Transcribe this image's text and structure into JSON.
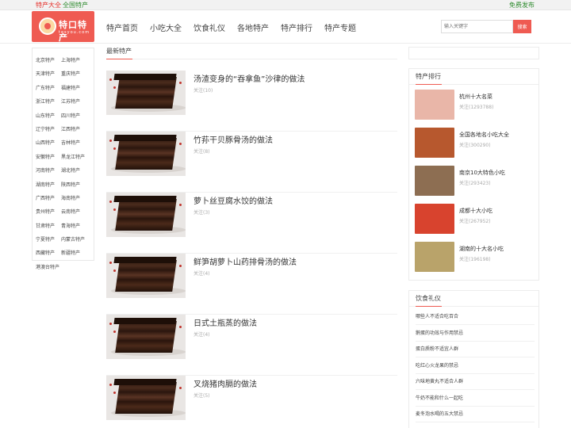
{
  "topbar": {
    "link1": "特产大全",
    "link2": "全国特产",
    "right": "免费发布"
  },
  "logo": {
    "text": "特口特产",
    "domain": "tesyou.com"
  },
  "nav": [
    "特产首页",
    "小吃大全",
    "饮食礼仪",
    "各地特产",
    "特产排行",
    "特产专题"
  ],
  "search": {
    "placeholder": "输入关键字",
    "button": "搜索"
  },
  "regions": [
    "北京特产",
    "上海特产",
    "天津特产",
    "重庆特产",
    "广东特产",
    "福建特产",
    "浙江特产",
    "江苏特产",
    "山东特产",
    "四川特产",
    "辽宁特产",
    "江西特产",
    "山西特产",
    "吉林特产",
    "安徽特产",
    "黑龙江特产",
    "河南特产",
    "湖北特产",
    "湖南特产",
    "陕西特产",
    "广西特产",
    "海南特产",
    "贵州特产",
    "云南特产",
    "甘肃特产",
    "青海特产",
    "宁夏特产",
    "内蒙古特产",
    "西藏特产",
    "新疆特产",
    "港澳台特产"
  ],
  "main": {
    "section_title": "最新特产",
    "items": [
      {
        "title": "汤渣变身的“吞拿鱼”沙律的做法",
        "meta": "关注(10)"
      },
      {
        "title": "竹荪干贝豚骨汤的做法",
        "meta": "关注(8)"
      },
      {
        "title": "萝卜丝豆腐水饺的做法",
        "meta": "关注(3)"
      },
      {
        "title": "鲜笋胡萝卜山药排骨汤的做法",
        "meta": "关注(4)"
      },
      {
        "title": "日式土瓶蒸的做法",
        "meta": "关注(4)"
      },
      {
        "title": "叉烧猪肉膈的做法",
        "meta": "关注(5)"
      }
    ]
  },
  "ranking": {
    "title": "特产排行",
    "items": [
      {
        "name": "杭州十大名菜",
        "count": "关注(1293788)",
        "color": "#e9b6a8"
      },
      {
        "name": "全国各地名小吃大全",
        "count": "关注(300290)",
        "color": "#b7582e"
      },
      {
        "name": "南京10大特色小吃",
        "count": "关注(293423)",
        "color": "#8d6e52"
      },
      {
        "name": "成都十大小吃",
        "count": "关注(267952)",
        "color": "#d8432e"
      },
      {
        "name": "湖南的十大名小吃",
        "count": "关注(196198)",
        "color": "#b9a36a"
      }
    ]
  },
  "gifts": {
    "title": "饮食礼仪",
    "items": [
      "哪些人不适合吃百合",
      "鹅蛋的功效与作用禁忌",
      "蛋白质粉不适宜人群",
      "吃红心火龙果的禁忌",
      "六味地黄丸不适合人群",
      "牛奶不能和什么一起吃",
      "麦冬泡水喝的五大禁忌"
    ]
  },
  "colors": {
    "accent": "#ef5b52",
    "green": "#2e8b2e"
  }
}
